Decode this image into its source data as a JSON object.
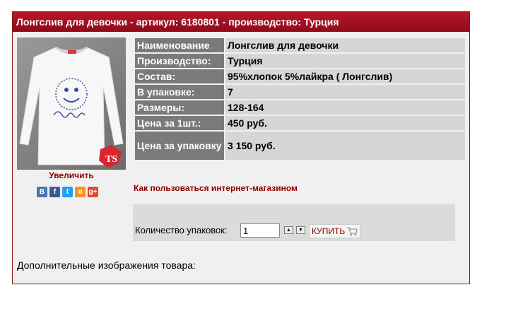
{
  "title": "Лонгслив для девочки - артикул: 6180801 - производство: Турция",
  "image_link": "Увеличить",
  "share_icons": [
    "В",
    "f",
    "t",
    "о",
    "g+"
  ],
  "properties": [
    {
      "key": "Наименование",
      "value": "Лонгслив для девочки"
    },
    {
      "key": "Производство:",
      "value": "Турция"
    },
    {
      "key": "Состав:",
      "value": "95%хлопок 5%лайкра ( Лонгслив)"
    },
    {
      "key": "В упаковке:",
      "value": "7"
    },
    {
      "key": "Размеры:",
      "value": "128-164"
    },
    {
      "key": "Цена за 1шт.:",
      "value": "450 руб."
    },
    {
      "key": "Цена за упаковку",
      "value": "3 150 руб."
    }
  ],
  "help_link": "Как пользоваться интернет-магазином",
  "order": {
    "qty_label": "Количество упаковок:",
    "qty_value": "1",
    "buy_label": "КУПИТЬ"
  },
  "extra_images_label": "Дополнительные изображения товара:",
  "colors": {
    "title_bar": "#a8102a",
    "key_cell": "#7a7a7a",
    "value_cell": "#d6d6d6",
    "link": "#8b0000"
  }
}
